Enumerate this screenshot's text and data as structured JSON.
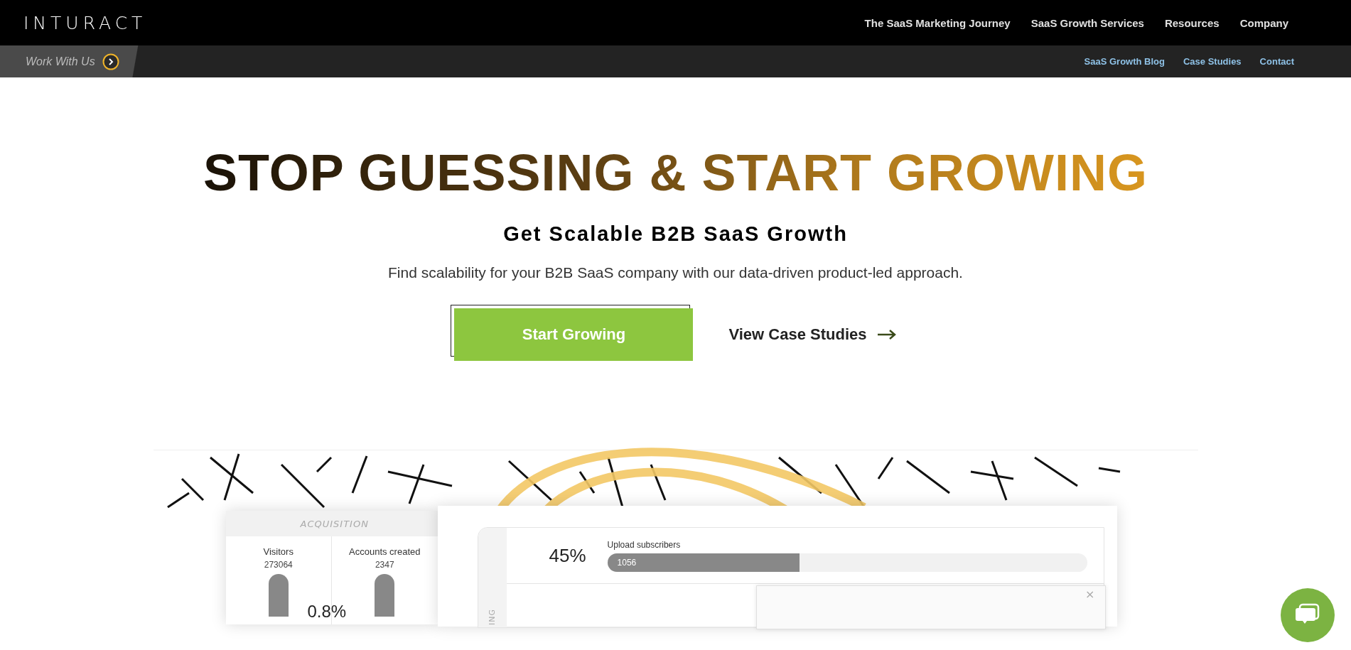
{
  "header": {
    "logo": "INTURACT",
    "nav": [
      "The SaaS Marketing Journey",
      "SaaS Growth Services",
      "Resources",
      "Company"
    ]
  },
  "subbar": {
    "cta": "Work With Us",
    "links": [
      "SaaS Growth Blog",
      "Case Studies",
      "Contact"
    ]
  },
  "hero": {
    "title": "STOP GUESSING & START GROWING",
    "subtitle": "Get Scalable B2B SaaS Growth",
    "text": "Find scalability for your B2B SaaS company with our data-driven product-led approach.",
    "primary_button": "Start Growing",
    "secondary_link": "View Case Studies"
  },
  "illustration": {
    "section": "ACQUISITION",
    "metrics": [
      {
        "label": "Visitors",
        "value": "273064"
      },
      {
        "label": "Accounts created",
        "value": "2347"
      }
    ],
    "conversion": "0.8%",
    "side_label": "ING",
    "step": {
      "percent": "45%",
      "label": "Upload subscribers",
      "value": "1056",
      "level": 0.4
    },
    "popup_close": "×"
  }
}
